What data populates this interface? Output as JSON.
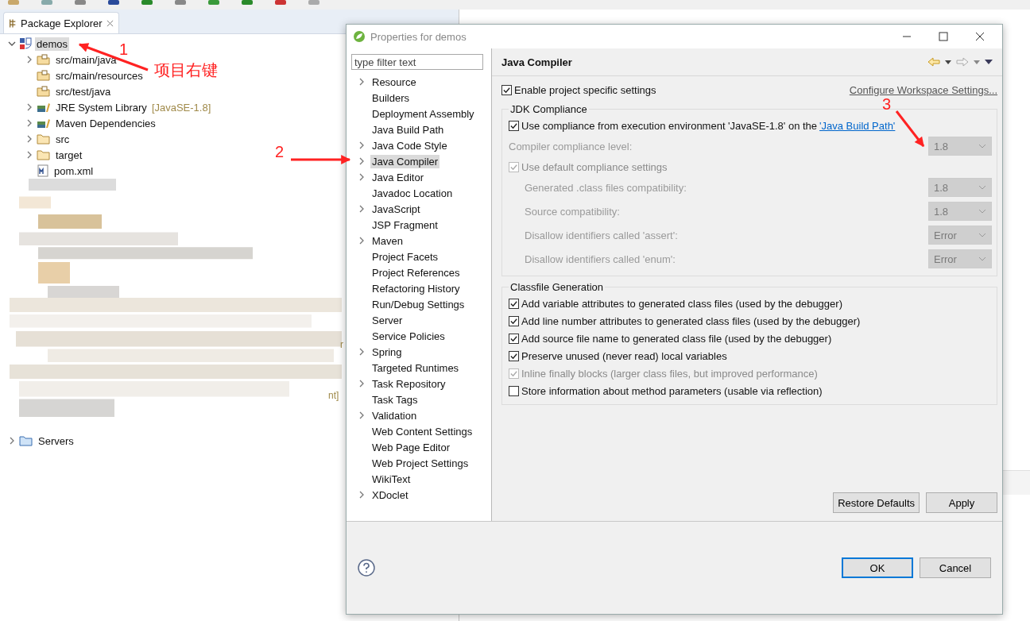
{
  "package_explorer": {
    "tab": {
      "label": "Package Explorer",
      "selected": true
    },
    "tree": [
      {
        "kind": "project",
        "label": "demos",
        "selected": true,
        "has_children": true,
        "expanded": true,
        "children": [
          {
            "kind": "source",
            "label": "src/main/java",
            "has_children": true
          },
          {
            "kind": "source",
            "label": "src/main/resources",
            "has_children": false
          },
          {
            "kind": "source",
            "label": "src/test/java",
            "has_children": false
          },
          {
            "kind": "library",
            "label": "JRE System Library",
            "decoration": "[JavaSE-1.8]",
            "has_children": true
          },
          {
            "kind": "library",
            "label": "Maven Dependencies",
            "has_children": true
          },
          {
            "kind": "folder",
            "label": "src",
            "has_children": true
          },
          {
            "kind": "folder",
            "label": "target",
            "has_children": true
          },
          {
            "kind": "pom",
            "label": "pom.xml",
            "has_children": false
          }
        ]
      }
    ],
    "cut_fragments": [
      "r",
      "nt]"
    ],
    "after": [
      {
        "kind": "servers",
        "label": "Servers",
        "selected": false,
        "has_children": true,
        "expanded": false
      }
    ]
  },
  "annotations": [
    {
      "number": "1",
      "note": "项目右键"
    },
    {
      "number": "2"
    },
    {
      "number": "3"
    }
  ],
  "dialog": {
    "title": "Properties for demos",
    "filter": {
      "placeholder": "type filter text"
    },
    "pages": [
      {
        "label": "Resource",
        "has_children": true,
        "selected": false
      },
      {
        "label": "Builders",
        "has_children": false,
        "selected": false
      },
      {
        "label": "Deployment Assembly",
        "has_children": false,
        "selected": false
      },
      {
        "label": "Java Build Path",
        "has_children": false,
        "selected": false
      },
      {
        "label": "Java Code Style",
        "has_children": true,
        "selected": false
      },
      {
        "label": "Java Compiler",
        "has_children": true,
        "selected": true
      },
      {
        "label": "Java Editor",
        "has_children": true,
        "selected": false
      },
      {
        "label": "Javadoc Location",
        "has_children": false,
        "selected": false
      },
      {
        "label": "JavaScript",
        "has_children": true,
        "selected": false
      },
      {
        "label": "JSP Fragment",
        "has_children": false,
        "selected": false
      },
      {
        "label": "Maven",
        "has_children": true,
        "selected": false
      },
      {
        "label": "Project Facets",
        "has_children": false,
        "selected": false
      },
      {
        "label": "Project References",
        "has_children": false,
        "selected": false
      },
      {
        "label": "Refactoring History",
        "has_children": false,
        "selected": false
      },
      {
        "label": "Run/Debug Settings",
        "has_children": false,
        "selected": false
      },
      {
        "label": "Server",
        "has_children": false,
        "selected": false
      },
      {
        "label": "Service Policies",
        "has_children": false,
        "selected": false
      },
      {
        "label": "Spring",
        "has_children": true,
        "selected": false
      },
      {
        "label": "Targeted Runtimes",
        "has_children": false,
        "selected": false
      },
      {
        "label": "Task Repository",
        "has_children": true,
        "selected": false
      },
      {
        "label": "Task Tags",
        "has_children": false,
        "selected": false
      },
      {
        "label": "Validation",
        "has_children": true,
        "selected": false
      },
      {
        "label": "Web Content Settings",
        "has_children": false,
        "selected": false
      },
      {
        "label": "Web Page Editor",
        "has_children": false,
        "selected": false
      },
      {
        "label": "Web Project Settings",
        "has_children": false,
        "selected": false
      },
      {
        "label": "WikiText",
        "has_children": false,
        "selected": false
      },
      {
        "label": "XDoclet",
        "has_children": true,
        "selected": false
      }
    ],
    "page_title": "Java Compiler",
    "enable_specific": {
      "label": "Enable project specific settings",
      "checked": true
    },
    "workspace_link": "Configure Workspace Settings...",
    "jdk_group": {
      "title": "JDK Compliance",
      "rows": [
        {
          "kind": "check",
          "label": "Use compliance from execution environment 'JavaSE-1.8' on the",
          "link": "'Java Build Path'",
          "checked": true,
          "disabled": false
        },
        {
          "kind": "combo",
          "label": "Compiler compliance level:",
          "value": "1.8",
          "disabled": true
        },
        {
          "kind": "check",
          "label": "Use default compliance settings",
          "checked": true,
          "disabled": true,
          "children": [
            {
              "kind": "combo",
              "label": "Generated .class files compatibility:",
              "value": "1.8",
              "disabled": true
            },
            {
              "kind": "combo",
              "label": "Source compatibility:",
              "value": "1.8",
              "disabled": true
            },
            {
              "kind": "combo",
              "label": "Disallow identifiers called 'assert':",
              "value": "Error",
              "disabled": true
            },
            {
              "kind": "combo",
              "label": "Disallow identifiers called 'enum':",
              "value": "Error",
              "disabled": true
            }
          ]
        }
      ]
    },
    "classfile_group": {
      "title": "Classfile Generation",
      "options": [
        {
          "label": "Add variable attributes to generated class files (used by the debugger)",
          "checked": true,
          "disabled": false
        },
        {
          "label": "Add line number attributes to generated class files (used by the debugger)",
          "checked": true,
          "disabled": false
        },
        {
          "label": "Add source file name to generated class file (used by the debugger)",
          "checked": true,
          "disabled": false
        },
        {
          "label": "Preserve unused (never read) local variables",
          "checked": true,
          "disabled": false
        },
        {
          "label": "Inline finally blocks (larger class files, but improved performance)",
          "checked": true,
          "disabled": true
        },
        {
          "label": "Store information about method parameters (usable via reflection)",
          "checked": false,
          "disabled": false
        }
      ]
    },
    "page_buttons": [
      "Restore Defaults",
      "Apply"
    ],
    "footer_buttons": [
      {
        "label": "OK",
        "default": true
      },
      {
        "label": "Cancel",
        "default": false
      }
    ]
  }
}
